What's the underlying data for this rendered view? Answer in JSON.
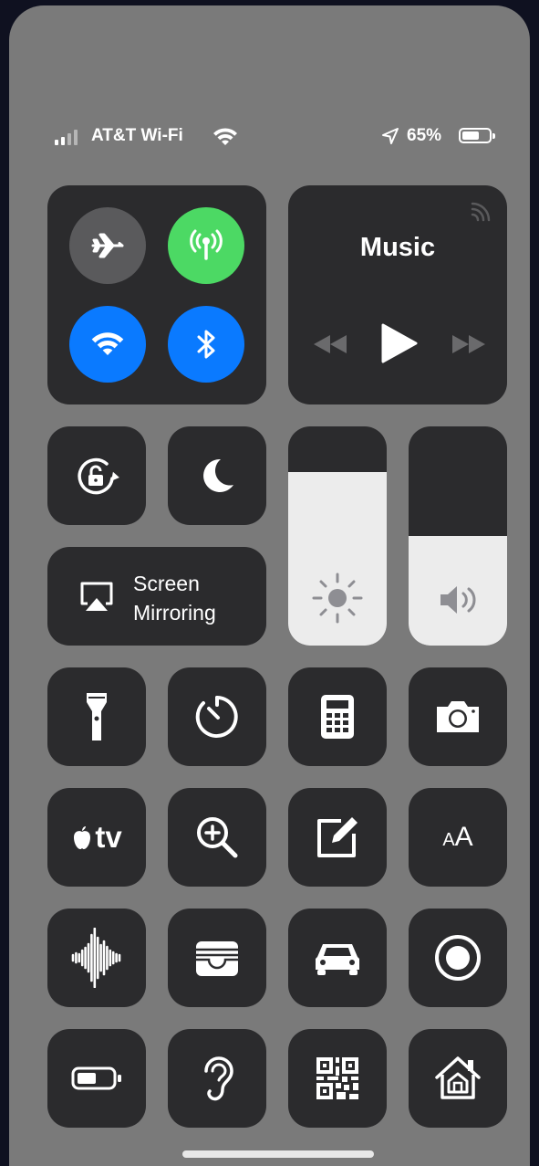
{
  "status_bar": {
    "carrier": "AT&T Wi-Fi",
    "battery_percent": "65%",
    "battery_level": 0.65,
    "signal_bars": 2
  },
  "connectivity": {
    "airplane_mode": {
      "state": "off",
      "color": "#5a5a5c"
    },
    "cellular_data": {
      "state": "on",
      "color": "#4cd964"
    },
    "wifi": {
      "state": "on",
      "color": "#0a7aff"
    },
    "bluetooth": {
      "state": "on",
      "color": "#0a7aff"
    }
  },
  "music": {
    "title": "Music"
  },
  "screen_mirroring": {
    "label_line1": "Screen",
    "label_line2": "Mirroring"
  },
  "sliders": {
    "brightness_level": 0.79,
    "volume_level": 0.5
  },
  "controls": [
    "orientation-lock-icon",
    "do-not-disturb-icon",
    "flashlight-icon",
    "timer-icon",
    "calculator-icon",
    "camera-icon",
    "apple-tv-remote-icon",
    "magnifier-icon",
    "notes-icon",
    "text-size-icon",
    "voice-memos-icon",
    "wallet-icon",
    "do-not-disturb-while-driving-icon",
    "screen-recording-icon",
    "low-power-mode-icon",
    "hearing-icon",
    "qr-scanner-icon",
    "home-icon"
  ],
  "apple_tv": {
    "label": "tv"
  },
  "text_size": {
    "small": "A",
    "large": "A"
  }
}
